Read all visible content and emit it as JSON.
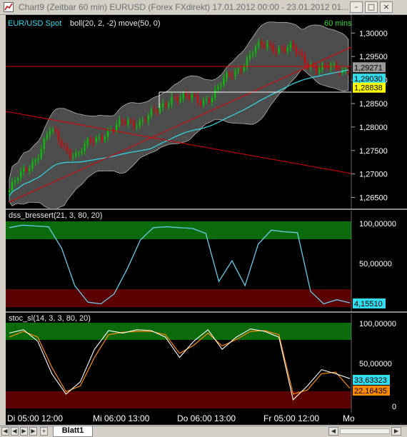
{
  "window": {
    "title": "Chart9 (Zeitbar 60 min)  EURUSD (Forex FXdirekt) 17.01.2012 00:00 - 23.01.2012 01...",
    "buttons": [
      "minimize-button",
      "maximize-button",
      "close-button"
    ]
  },
  "colors": {
    "background": "#000000",
    "price_axis_bg": "#000000",
    "bollinger_fill": "#5a5a5a",
    "bull_candle": "#00cc00",
    "bear_candle": "#dd0000",
    "moving_average": "#33ddee",
    "trendline": "#e00000",
    "zone_high": "#0b6b0b",
    "zone_low": "#5a0000",
    "dss_line": "#66ccee",
    "stoc_k": "#ffffff",
    "stoc_d": "#ff8800"
  },
  "price_panel": {
    "title": "EUR/USD Spot",
    "indicators": "boll(20, 2, -2) move(50, 0)",
    "timeframe": "60 mins",
    "axis_ticks": [
      "1,30000",
      "1,29500",
      "1,29000",
      "1,28500",
      "1,28000",
      "1,27500",
      "1,27000",
      "1,26500"
    ],
    "markers": [
      {
        "value": "1,29271",
        "bg": "#9a9a9a",
        "fg": "#000000"
      },
      {
        "value": "1,29030",
        "bg": "#33ddee",
        "fg": "#000000"
      },
      {
        "value": "1,28838",
        "bg": "#ffff00",
        "fg": "#000000"
      }
    ]
  },
  "dss_panel": {
    "title": "dss_bressert(21, 3, 80, 20)",
    "axis_ticks": [
      "100,00000",
      "50,00000"
    ],
    "value_marker": "4,15510"
  },
  "stoc_panel": {
    "title": "stoc_sl(14, 3, 3, 80, 20)",
    "axis_ticks": [
      "100,00000",
      "50,00000",
      "0"
    ],
    "markers": [
      "33,63323",
      "22,16435"
    ]
  },
  "time_axis": {
    "labels": [
      "Di 05:00 12:00",
      "Mi  06:00 13:00",
      "Do  06:00 13:00",
      "Fr 05:00 12:00",
      "Mo"
    ]
  },
  "sheet_tabs": {
    "active": "Blatt1",
    "nav_buttons": [
      "first-sheet-button",
      "prev-sheet-button",
      "next-sheet-button",
      "last-sheet-button"
    ]
  },
  "chart_data": {
    "type": "candlestick",
    "instrument": "EURUSD",
    "period": "60 min",
    "range": "17.01.2012 00:00 - 23.01.2012 01",
    "ylim_price": [
      1.2625,
      1.3005
    ],
    "price_path": [
      1.2665,
      1.27,
      1.274,
      1.279,
      1.276,
      1.274,
      1.2765,
      1.279,
      1.28,
      1.281,
      1.282,
      1.283,
      1.287,
      1.286,
      1.2855,
      1.287,
      1.29,
      1.293,
      1.296,
      1.2975,
      1.297,
      1.296,
      1.294,
      1.292,
      1.2925,
      1.2927
    ],
    "dss_path": [
      95,
      98,
      97,
      96,
      70,
      25,
      5,
      3,
      15,
      45,
      80,
      95,
      96,
      95,
      94,
      88,
      30,
      55,
      25,
      75,
      92,
      90,
      89,
      18,
      3,
      8,
      4.2
    ],
    "stoc_k_path": [
      90,
      94,
      80,
      40,
      15,
      30,
      70,
      93,
      90,
      94,
      93,
      85,
      60,
      80,
      94,
      70,
      85,
      95,
      92,
      85,
      8,
      25,
      45,
      40,
      34
    ],
    "stoc_d_path": [
      85,
      92,
      85,
      48,
      18,
      25,
      60,
      88,
      91,
      92,
      92,
      88,
      65,
      75,
      90,
      74,
      82,
      92,
      93,
      88,
      15,
      20,
      40,
      42,
      22
    ]
  }
}
